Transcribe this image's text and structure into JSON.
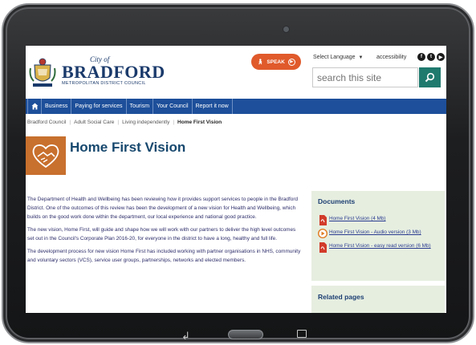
{
  "header": {
    "logo_city_of": "City of",
    "logo_name": "BRADFORD",
    "logo_subtitle": "METROPOLITAN DISTRICT COUNCIL",
    "speak_label": "SPEAK",
    "language_label": "Select Language",
    "accessibility_label": "accessibility",
    "search_placeholder": "search this site"
  },
  "nav": {
    "items": [
      {
        "label": "Business"
      },
      {
        "label": "Paying for services"
      },
      {
        "label": "Tourism"
      },
      {
        "label": "Your Council"
      },
      {
        "label": "Report it now"
      }
    ]
  },
  "breadcrumb": {
    "items": [
      "Bradford Council",
      "Adult Social Care",
      "Living independently"
    ],
    "current": "Home First Vision"
  },
  "page": {
    "title": "Home First Vision",
    "paragraphs": [
      "The Department of Health and Wellbeing has been reviewing how it provides support services to people in the Bradford District.  One of the outcomes of this review has been the development of a new vision for Health and Wellbeing, which builds on the good work done within the department, our local experience and national good practice.",
      "The new vision, Home First, will guide and shape how we will work with our partners to deliver the high level outcomes set out in the Council's Corporate Plan 2016-20, for everyone in the district to have a long, healthy and full life.",
      "The development process for new vision Home First has included working with partner organisations in NHS, community and voluntary sectors (VCS), service user groups, partnerships, networks and elected members."
    ]
  },
  "sidebar": {
    "documents_title": "Documents",
    "documents": [
      {
        "label": "Home First Vision (4 Mb)",
        "icon": "pdf-icon"
      },
      {
        "label": "Home First Vision - Audio version (3 Mb)",
        "icon": "audio-play-icon"
      },
      {
        "label": "Home First Vision - easy read version (6 Mb)",
        "icon": "pdf-icon"
      }
    ],
    "related_title": "Related pages"
  },
  "colors": {
    "nav_blue": "#1d4f9a",
    "speak_orange": "#e05a2b",
    "search_green": "#1f7a6e",
    "hero_orange": "#c8702e",
    "title_blue": "#17486e",
    "sidebar_bg": "#e6eee0"
  }
}
